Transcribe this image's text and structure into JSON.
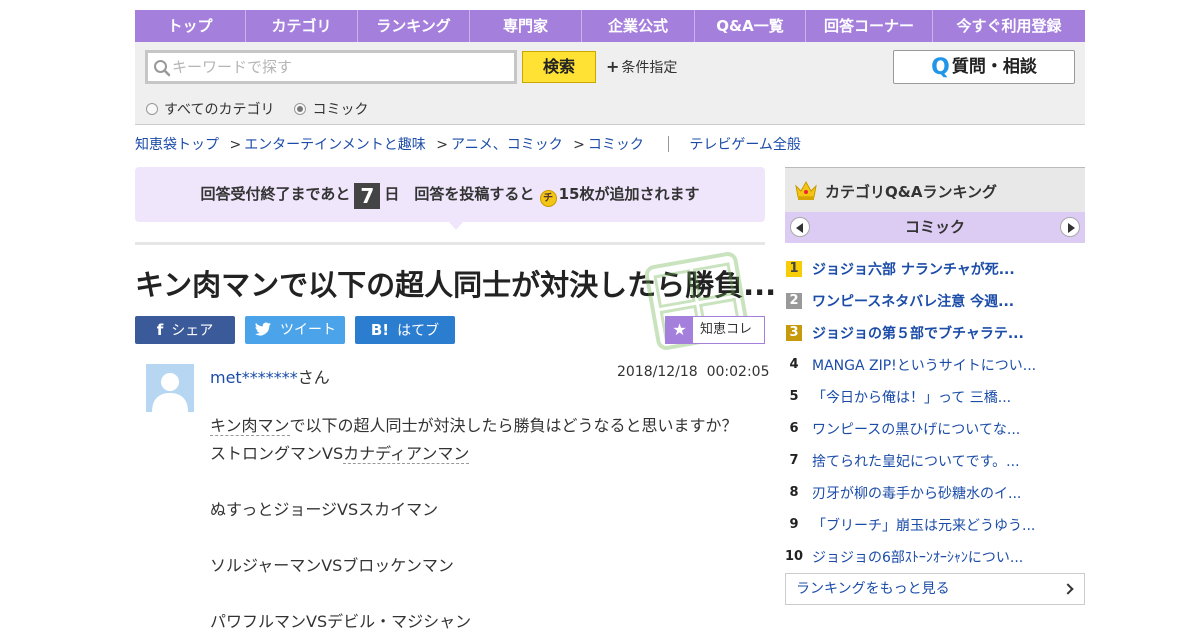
{
  "nav": {
    "items": [
      "トップ",
      "カテゴリ",
      "ランキング",
      "専門家",
      "企業公式",
      "Q&A一覧",
      "回答コーナー",
      "今すぐ利用登録"
    ]
  },
  "search": {
    "placeholder": "キーワードで探す",
    "button": "検索",
    "condition": "条件指定",
    "ask_button": "質問・相談",
    "scope_all": "すべてのカテゴリ",
    "scope_current": "コミック",
    "selected_scope": "コミック"
  },
  "breadcrumb": {
    "items": [
      "知恵袋トップ",
      "エンターテインメントと趣味",
      "アニメ、コミック",
      "コミック"
    ],
    "separator": ">",
    "related": "テレビゲーム全般"
  },
  "notice": {
    "prefix": "回答受付終了まであと",
    "days": "7",
    "days_unit": "日",
    "middle": "回答を投稿すると",
    "coin_icon": "チ",
    "suffix": "15枚が追加されます"
  },
  "question": {
    "title": "キン肉マンで以下の超人同士が対決したら勝負...",
    "user": "met*******",
    "user_suffix": "さん",
    "date": "2018/12/18",
    "time": "00:02:05",
    "body": {
      "line1_kw": "キン肉マン",
      "line1_rest": "で以下の超人同士が対決したら勝負はどうなると思いますか？",
      "line2_pre": "ストロングマンVS",
      "line2_kw": "カナディアンマン",
      "line3": "ぬすっとジョージVSスカイマン",
      "line4": "ソルジャーマンVSブロッケンマン",
      "line5": "パワフルマンVSデビル・マジシャン"
    }
  },
  "share": {
    "facebook": "シェア",
    "twitter": "ツイート",
    "hatena": "はてブ",
    "hatena_icon": "B!",
    "chiekore": "知恵コレ"
  },
  "ranking": {
    "title": "カテゴリQ&Aランキング",
    "category": "コミック",
    "items": [
      {
        "rank": "1",
        "title": "ジョジョ六部 ナランチャが死..."
      },
      {
        "rank": "2",
        "title": "ワンピースネタバレ注意 今週..."
      },
      {
        "rank": "3",
        "title": "ジョジョの第５部でブチャラテ..."
      },
      {
        "rank": "4",
        "title": "MANGA ZIP!というサイトについ..."
      },
      {
        "rank": "5",
        "title": "「今日から俺は！」って 三橋..."
      },
      {
        "rank": "6",
        "title": "ワンピースの黒ひげについてな..."
      },
      {
        "rank": "7",
        "title": "捨てられた皇妃についてです。..."
      },
      {
        "rank": "8",
        "title": "刃牙が柳の毒手から砂糖水のイ..."
      },
      {
        "rank": "9",
        "title": "「ブリーチ」崩玉は元来どうゆう..."
      },
      {
        "rank": "10",
        "title": "ジョジョの6部ｽﾄｰﾝｵｰｼｬﾝについ..."
      }
    ],
    "more": "ランキングをもっと見る"
  },
  "colors": {
    "nav": "#a57fdc",
    "link": "#1b4ca8",
    "search_button": "#ffe234",
    "facebook": "#3b5a99",
    "twitter": "#4ba4ea",
    "hatena": "#2b7dcf",
    "notice_bg": "#efe6fb"
  }
}
